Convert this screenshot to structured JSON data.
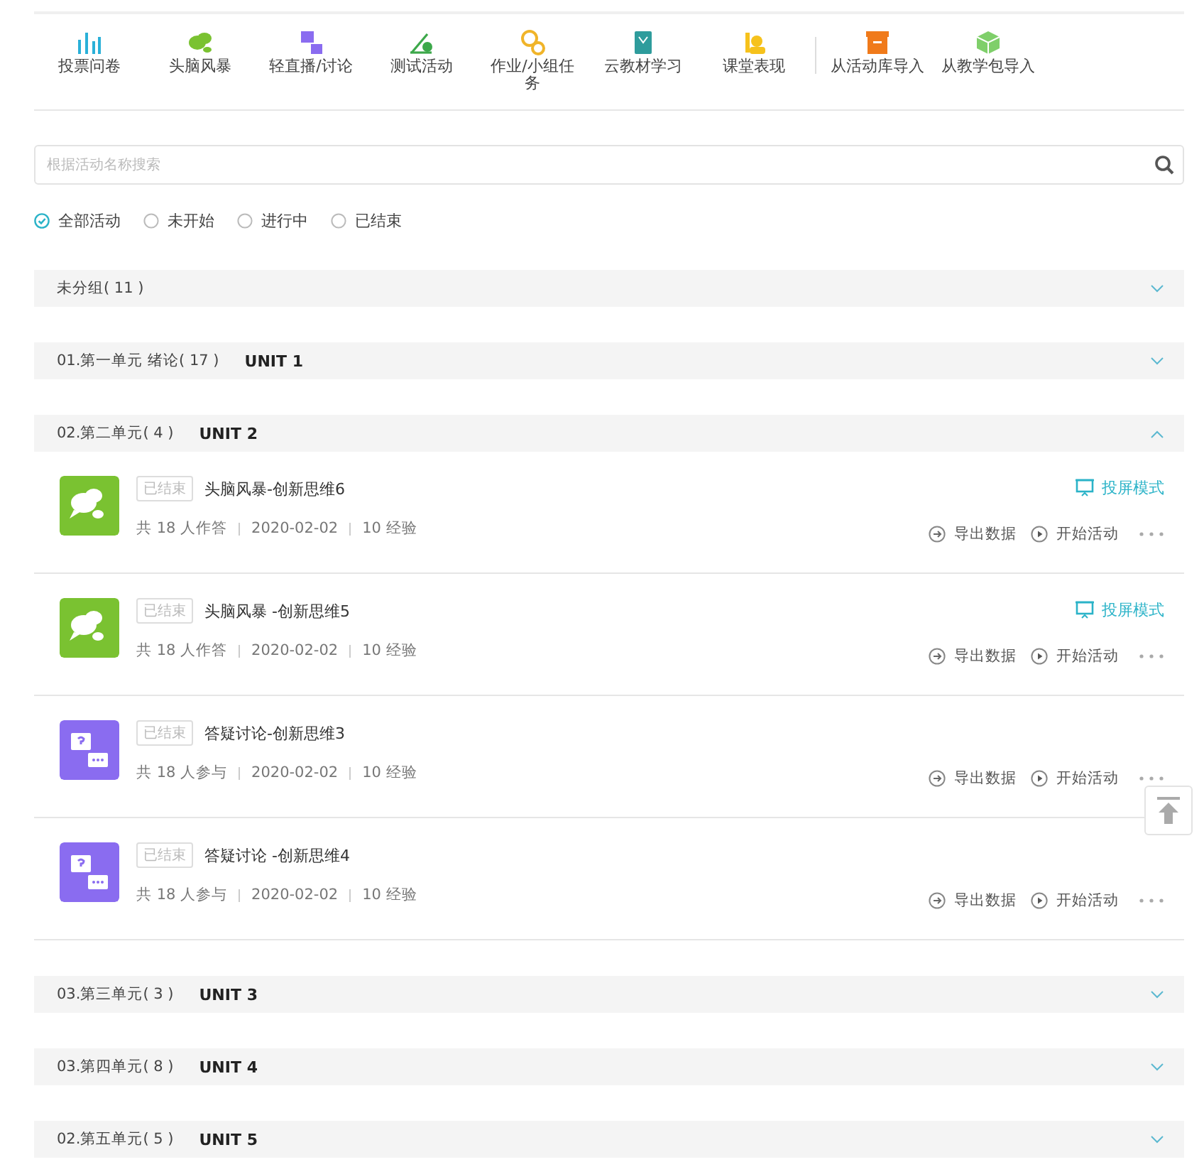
{
  "toolbar": {
    "sections": [
      {
        "items": [
          {
            "label": "投票问卷",
            "kind": "bars"
          },
          {
            "label": "头脑风暴",
            "kind": "chat"
          },
          {
            "label": "轻直播/讨论",
            "kind": "qa"
          },
          {
            "label": "测试活动",
            "kind": "test"
          },
          {
            "label": "作业/小组任务",
            "kind": "task"
          },
          {
            "label": "云教材学习",
            "kind": "book"
          },
          {
            "label": "课堂表现",
            "kind": "person"
          }
        ]
      },
      {
        "items": [
          {
            "label": "从活动库导入",
            "kind": "archive"
          },
          {
            "label": "从教学包导入",
            "kind": "package"
          }
        ]
      }
    ]
  },
  "search": {
    "placeholder": "根据活动名称搜索"
  },
  "filters": [
    {
      "label": "全部活动",
      "selected": true
    },
    {
      "label": "未开始",
      "selected": false
    },
    {
      "label": "进行中",
      "selected": false
    },
    {
      "label": "已结束",
      "selected": false
    }
  ],
  "groups": [
    {
      "name": "未分组( 11 )",
      "expanded": false
    },
    {
      "name": "01.第一单元 绪论( 17 )",
      "unit": "UNIT 1",
      "expanded": false
    },
    {
      "name": "02.第二单元( 4 )",
      "unit": "UNIT 2",
      "expanded": true,
      "activities": [
        {
          "kind": "brainstorm",
          "status": "已结束",
          "title": "头脑风暴-创新思维6",
          "meta": [
            "共 18 人作答",
            "2020-02-02",
            "10 经验"
          ],
          "projection": "投屏模式",
          "actions": [
            {
              "kind": "export",
              "label": "导出数据"
            },
            {
              "kind": "start",
              "label": "开始活动"
            }
          ]
        },
        {
          "kind": "brainstorm",
          "status": "已结束",
          "title": "头脑风暴 -创新思维5",
          "meta": [
            "共 18 人作答",
            "2020-02-02",
            "10 经验"
          ],
          "projection": "投屏模式",
          "actions": [
            {
              "kind": "export",
              "label": "导出数据"
            },
            {
              "kind": "start",
              "label": "开始活动"
            }
          ]
        },
        {
          "kind": "qa",
          "status": "已结束",
          "title": "答疑讨论-创新思维3",
          "meta": [
            "共 18 人参与",
            "2020-02-02",
            "10 经验"
          ],
          "actions": [
            {
              "kind": "export",
              "label": "导出数据"
            },
            {
              "kind": "start",
              "label": "开始活动"
            }
          ]
        },
        {
          "kind": "qa",
          "status": "已结束",
          "title": "答疑讨论 -创新思维4",
          "meta": [
            "共 18 人参与",
            "2020-02-02",
            "10 经验"
          ],
          "actions": [
            {
              "kind": "export",
              "label": "导出数据"
            },
            {
              "kind": "start",
              "label": "开始活动"
            }
          ]
        }
      ]
    },
    {
      "name": "03.第三单元( 3 )",
      "unit": "UNIT 3",
      "expanded": false
    },
    {
      "name": "03.第四单元( 8 )",
      "unit": "UNIT 4",
      "expanded": false
    },
    {
      "name": "02.第五单元( 5 )",
      "unit": "UNIT 5",
      "expanded": false
    }
  ]
}
